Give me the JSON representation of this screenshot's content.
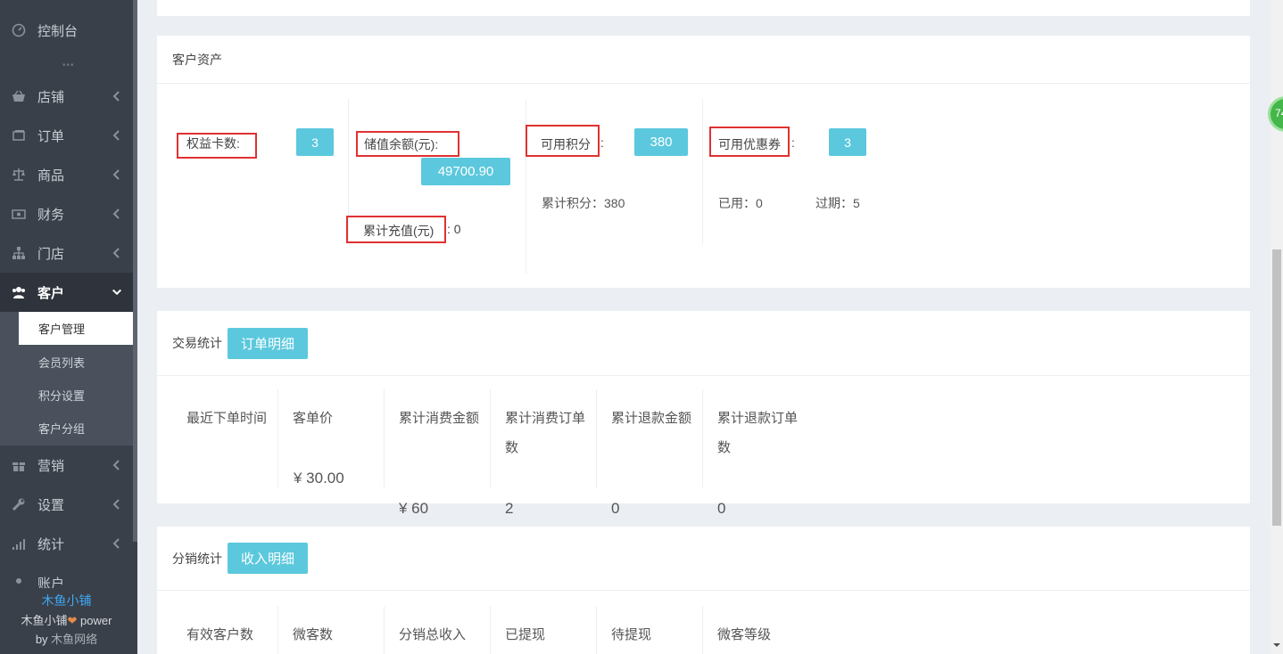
{
  "sidebar": {
    "items": [
      {
        "label": "控制台",
        "icon": "dashboard-icon"
      },
      {
        "label": "店铺",
        "icon": "shop-basket-icon"
      },
      {
        "label": "订单",
        "icon": "order-icon"
      },
      {
        "label": "商品",
        "icon": "scale-icon"
      },
      {
        "label": "财务",
        "icon": "money-icon"
      },
      {
        "label": "门店",
        "icon": "sitemap-icon"
      },
      {
        "label": "客户",
        "icon": "users-icon"
      },
      {
        "label": "营销",
        "icon": "gift-icon"
      },
      {
        "label": "设置",
        "icon": "wrench-icon"
      },
      {
        "label": "统计",
        "icon": "signal-icon"
      },
      {
        "label": "账户",
        "icon": "account-icon"
      }
    ],
    "dots": "•••",
    "submenu": [
      "客户管理",
      "会员列表",
      "积分设置",
      "客户分组"
    ],
    "footer": {
      "brand": "木鱼小铺",
      "power_prefix": "木鱼小铺",
      "power_suffix": " power",
      "by": "by",
      "company": "木鱼网络"
    }
  },
  "assets": {
    "title": "客户资产",
    "card_count_label": "权益卡数:",
    "card_count_value": "3",
    "balance_label": "储值余额(元):",
    "balance_value": "49700.90",
    "recharge_label": "累计充值(元)",
    "recharge_value": ": 0",
    "points_label": "可用积分",
    "points_colon": ":",
    "points_value": "380",
    "points_total": "累计积分：380",
    "coupon_label": "可用优惠券",
    "coupon_colon": ":",
    "coupon_value": "3",
    "coupon_used": "已用：0",
    "coupon_expired": "过期：5"
  },
  "trade": {
    "title": "交易统计",
    "button": "订单明细",
    "columns": [
      "最近下单时间",
      "客单价",
      "累计消费金额",
      "累计消费订单数",
      "累计退款金额",
      "累计退款订单数"
    ],
    "values": [
      "",
      "¥ 30.00",
      "¥ 60",
      "2",
      "0",
      "0"
    ]
  },
  "distribution": {
    "title": "分销统计",
    "button": "收入明细",
    "columns": [
      "有效客户数",
      "微客数",
      "分销总收入",
      "已提现",
      "待提现",
      "微客等级"
    ]
  },
  "bubble": "74"
}
